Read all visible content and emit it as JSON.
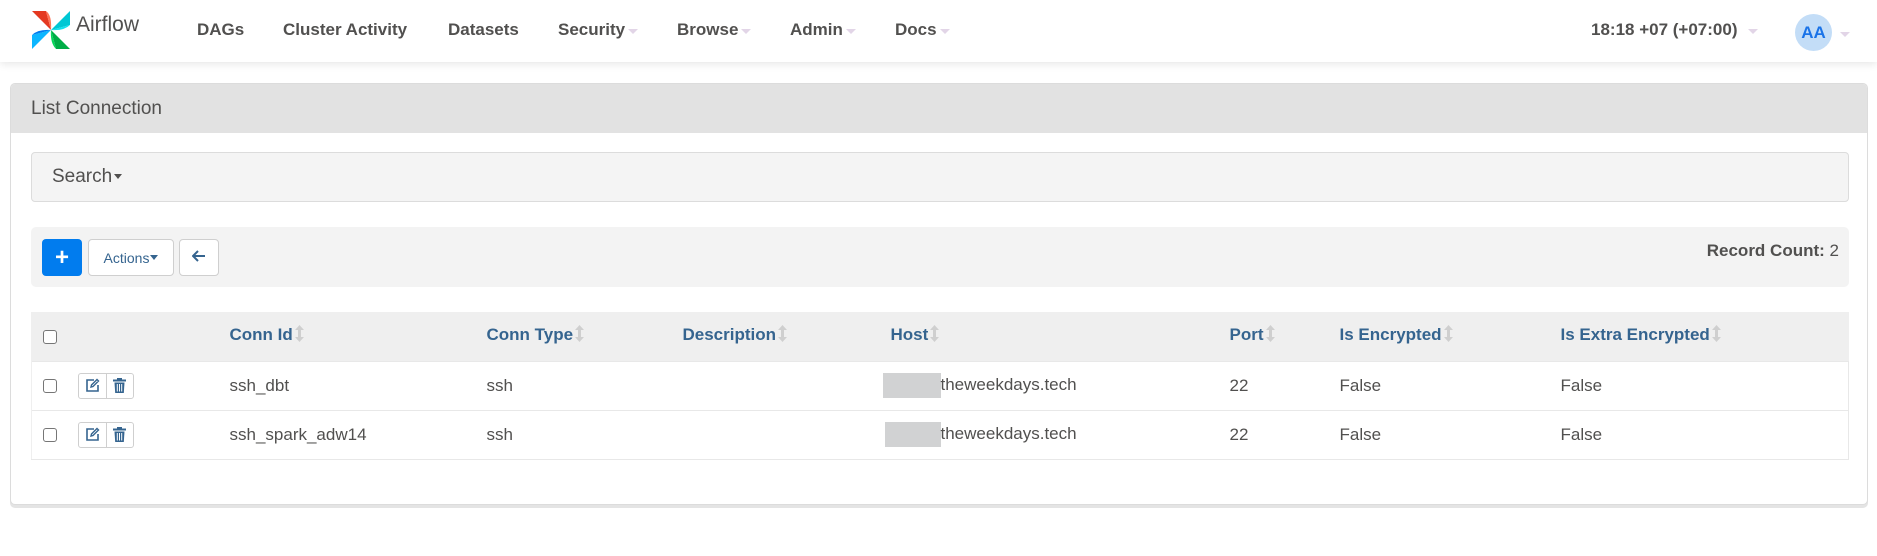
{
  "navbar": {
    "brand": "Airflow",
    "items": [
      {
        "label": "DAGs",
        "dropdown": false
      },
      {
        "label": "Cluster Activity",
        "dropdown": false
      },
      {
        "label": "Datasets",
        "dropdown": false
      },
      {
        "label": "Security",
        "dropdown": true
      },
      {
        "label": "Browse",
        "dropdown": true
      },
      {
        "label": "Admin",
        "dropdown": true
      },
      {
        "label": "Docs",
        "dropdown": true
      }
    ],
    "time": "18:18 +07 (+07:00)",
    "user_initials": "AA"
  },
  "panel": {
    "title": "List Connection",
    "search_label": "Search",
    "toolbar": {
      "add_label": "+",
      "actions_label": "Actions",
      "record_count_label": "Record Count:",
      "record_count": "2"
    },
    "table": {
      "columns": [
        "Conn Id",
        "Conn Type",
        "Description",
        "Host",
        "Port",
        "Is Encrypted",
        "Is Extra Encrypted"
      ],
      "rows": [
        {
          "conn_id": "ssh_dbt",
          "conn_type": "ssh",
          "description": "",
          "host": "theweekdays.tech",
          "port": "22",
          "is_encrypted": "False",
          "is_extra_encrypted": "False"
        },
        {
          "conn_id": "ssh_spark_adw14",
          "conn_type": "ssh",
          "description": "",
          "host": "theweekdays.tech",
          "port": "22",
          "is_encrypted": "False",
          "is_extra_encrypted": "False"
        }
      ]
    }
  },
  "colors": {
    "primary": "#017cee",
    "header_text": "#35648f",
    "panel_heading_bg": "#e2e2e2",
    "avatar_bg": "#c3ddf7"
  }
}
